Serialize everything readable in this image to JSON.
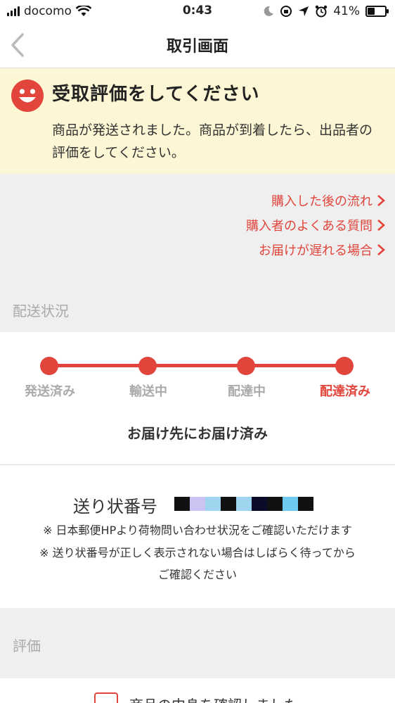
{
  "status_bar": {
    "carrier": "docomo",
    "time": "0:43",
    "battery_percent": "41%",
    "battery_level": 0.41,
    "icons": [
      "signal-icon",
      "wifi-icon",
      "moon-icon",
      "orientation-lock-icon",
      "location-icon",
      "alarm-icon",
      "battery-icon"
    ]
  },
  "nav": {
    "title": "取引画面"
  },
  "notice": {
    "title": "受取評価をしてください",
    "body": "商品が発送されました。商品が到着したら、出品者の評価をしてください。",
    "icon": "smiley-icon"
  },
  "help_links": [
    {
      "label": "購入した後の流れ"
    },
    {
      "label": "購入者のよくある質問"
    },
    {
      "label": "お届けが遅れる場合"
    }
  ],
  "shipping": {
    "section_label": "配送状況",
    "steps": [
      {
        "label": "発送済み",
        "active": false
      },
      {
        "label": "輸送中",
        "active": false
      },
      {
        "label": "配達中",
        "active": false
      },
      {
        "label": "配達済み",
        "active": true
      }
    ],
    "status_text": "お届け先にお届け済み"
  },
  "tracking": {
    "label": "送り状番号",
    "note1": "※ 日本郵便HPより荷物問い合わせ状況をご確認いただけます",
    "note2": "※ 送り状番号が正しく表示されない場合はしばらく待ってから",
    "note3": "ご確認ください"
  },
  "rating": {
    "section_label": "評価",
    "checkbox_label": "商品の中身を確認しました"
  },
  "colors": {
    "accent": "#e2453c",
    "notice_bg": "#fdf6d5",
    "section_bg": "#efefef"
  }
}
